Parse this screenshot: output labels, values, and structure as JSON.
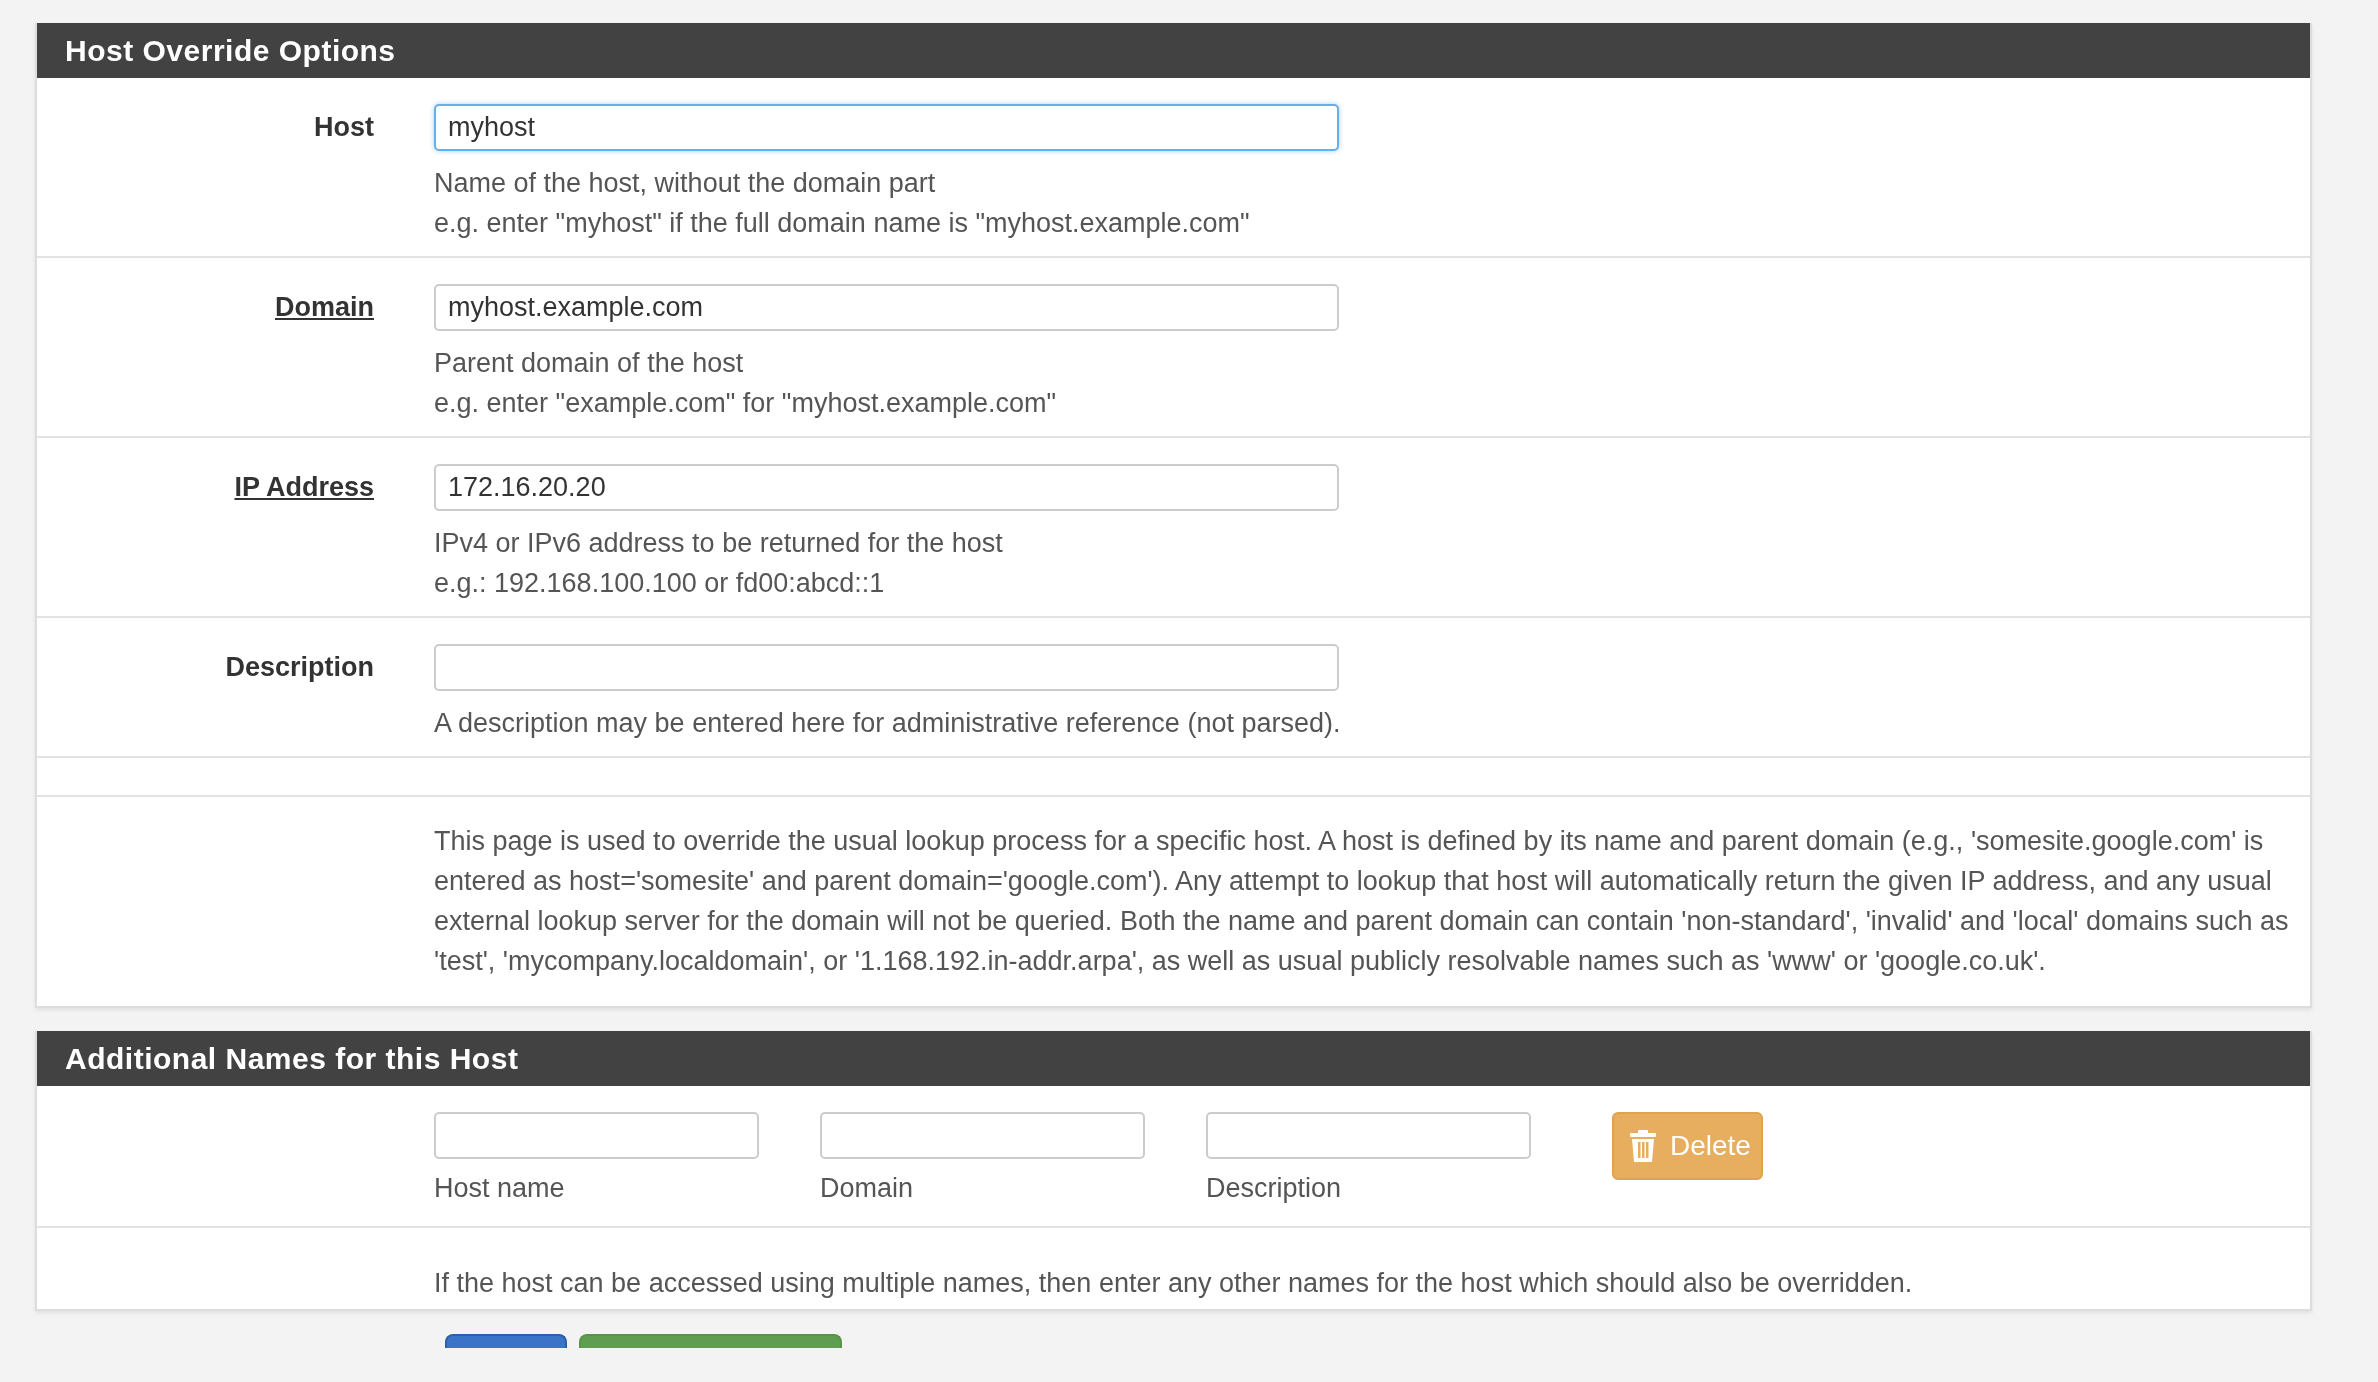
{
  "panels": [
    {
      "title": "Host Override Options",
      "kind": "fields",
      "fields": [
        {
          "label": "Host",
          "required": false,
          "value": "myhost",
          "focused": true,
          "help": [
            "Name of the host, without the domain part",
            "e.g. enter \"myhost\" if the full domain name is \"myhost.example.com\""
          ]
        },
        {
          "label": "Domain",
          "required": true,
          "value": "myhost.example.com",
          "focused": false,
          "help": [
            "Parent domain of the host",
            "e.g. enter \"example.com\" for \"myhost.example.com\""
          ]
        },
        {
          "label": "IP Address",
          "required": true,
          "value": "172.16.20.20",
          "focused": false,
          "help": [
            "IPv4 or IPv6 address to be returned for the host",
            "e.g.: 192.168.100.100 or fd00:abcd::1"
          ]
        },
        {
          "label": "Description",
          "required": false,
          "focused": false,
          "help": [
            "A description may be entered here for administrative reference (not parsed)."
          ]
        }
      ],
      "info": "This page is used to override the usual lookup process for a specific host. A host is defined by its name and parent domain (e.g., 'somesite.google.com' is entered as host='somesite' and parent domain='google.com'). Any attempt to lookup that host will automatically return the given IP address, and any usual external lookup server for the domain will not be queried. Both the name and parent domain can contain 'non-standard', 'invalid' and 'local' domains such as 'test', 'mycompany.localdomain', or '1.168.192.in-addr.arpa', as well as usual publicly resolvable names such as 'www' or 'google.co.uk'."
    },
    {
      "title": "Additional Names for this Host",
      "kind": "aliases",
      "columns": [
        {
          "label": "Host name"
        },
        {
          "label": "Domain"
        },
        {
          "label": "Description"
        }
      ],
      "delete_button": "Delete",
      "info": "If the host can be accessed using multiple names, then enter any other names for the host which should also be overridden."
    }
  ],
  "bottom_buttons": [
    {
      "kind": "primary"
    },
    {
      "kind": "success"
    }
  ]
}
